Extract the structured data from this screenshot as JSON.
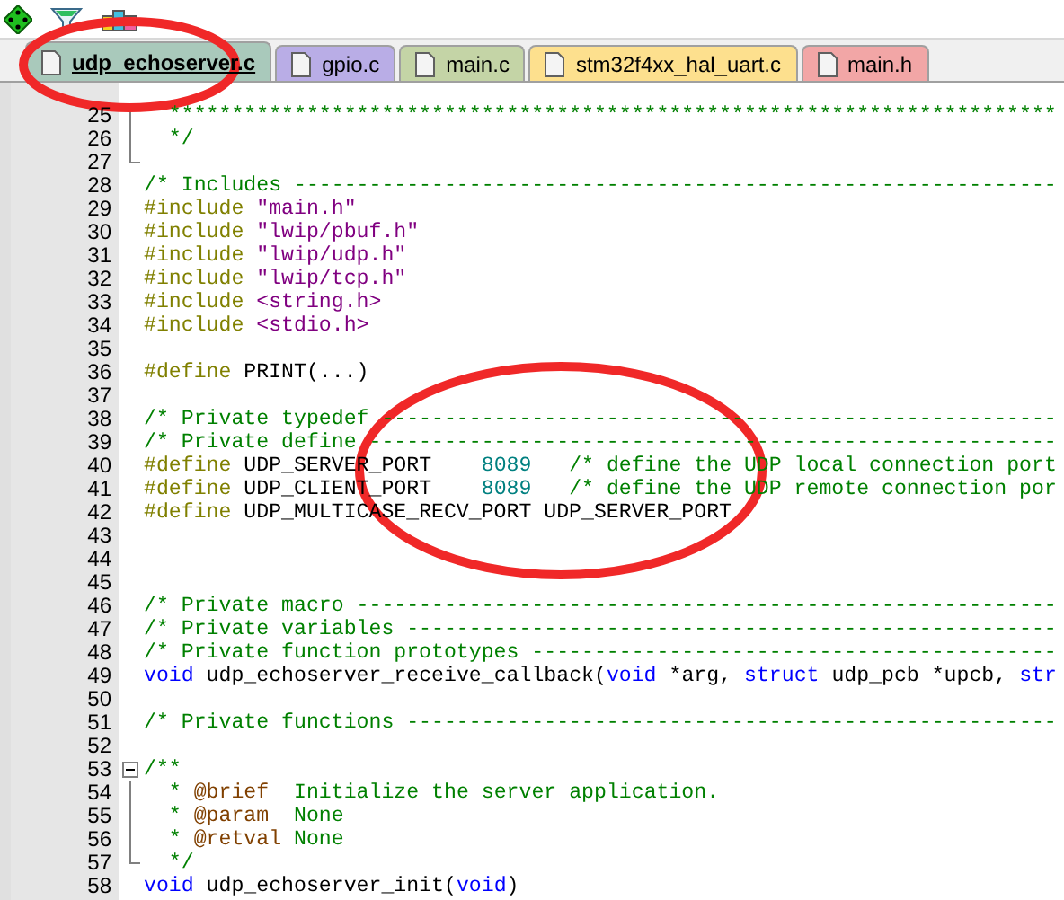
{
  "toolbar": {
    "buttons": [
      {
        "kind": "diamond"
      },
      {
        "kind": "funnel"
      },
      {
        "kind": "blocks"
      }
    ]
  },
  "tabs": [
    {
      "label": "udp_echoserver.c",
      "selected": true,
      "color": "#a9c9bb"
    },
    {
      "label": "gpio.c",
      "selected": false,
      "color": "#b9ade6"
    },
    {
      "label": "main.c",
      "selected": false,
      "color": "#c4d4a6"
    },
    {
      "label": "stm32f4xx_hal_uart.c",
      "selected": false,
      "color": "#fde08e"
    },
    {
      "label": "main.h",
      "selected": false,
      "color": "#f2a6a6"
    }
  ],
  "editor": {
    "lines": [
      {
        "number": "25",
        "kind": "foldline",
        "tokens": [
          {
            "text": "  ***********************************************************************",
            "kind": "comment"
          }
        ]
      },
      {
        "number": "26",
        "kind": "foldline",
        "tokens": [
          {
            "text": "  */",
            "kind": "comment"
          }
        ]
      },
      {
        "number": "27",
        "kind": "foldend"
      },
      {
        "number": "28",
        "tokens": [
          {
            "text": "/* Includes -------------------------------------------------------------",
            "kind": "comment"
          }
        ]
      },
      {
        "number": "29",
        "tokens": [
          {
            "text": "#include",
            "kind": "preproc"
          },
          {
            "text": " \"main.h\"",
            "kind": "string"
          }
        ]
      },
      {
        "number": "30",
        "tokens": [
          {
            "text": "#include",
            "kind": "preproc"
          },
          {
            "text": " \"lwip/pbuf.h\"",
            "kind": "string"
          }
        ]
      },
      {
        "number": "31",
        "tokens": [
          {
            "text": "#include",
            "kind": "preproc"
          },
          {
            "text": " \"lwip/udp.h\"",
            "kind": "string"
          }
        ]
      },
      {
        "number": "32",
        "tokens": [
          {
            "text": "#include",
            "kind": "preproc"
          },
          {
            "text": " \"lwip/tcp.h\"",
            "kind": "string"
          }
        ]
      },
      {
        "number": "33",
        "tokens": [
          {
            "text": "#include",
            "kind": "preproc"
          },
          {
            "text": " <string.h>",
            "kind": "string"
          }
        ]
      },
      {
        "number": "34",
        "tokens": [
          {
            "text": "#include",
            "kind": "preproc"
          },
          {
            "text": " <stdio.h>",
            "kind": "string"
          }
        ]
      },
      {
        "number": "35"
      },
      {
        "number": "36",
        "tokens": [
          {
            "text": "#define",
            "kind": "preproc"
          },
          {
            "text": " PRINT(...)",
            "kind": "plain"
          }
        ]
      },
      {
        "number": "37"
      },
      {
        "number": "38",
        "tokens": [
          {
            "text": "/* Private typedef ------------------------------------------------------",
            "kind": "comment"
          }
        ]
      },
      {
        "number": "39",
        "tokens": [
          {
            "text": "/* Private define -------------------------------------------------------",
            "kind": "comment"
          }
        ]
      },
      {
        "number": "40",
        "tokens": [
          {
            "text": "#define",
            "kind": "preproc"
          },
          {
            "text": " UDP_SERVER_PORT    ",
            "kind": "plain"
          },
          {
            "text": "8089",
            "kind": "number"
          },
          {
            "text": "   /* define the UDP local connection port",
            "kind": "comment"
          }
        ]
      },
      {
        "number": "41",
        "tokens": [
          {
            "text": "#define",
            "kind": "preproc"
          },
          {
            "text": " UDP_CLIENT_PORT    ",
            "kind": "plain"
          },
          {
            "text": "8089",
            "kind": "number"
          },
          {
            "text": "   /* define the UDP remote connection por",
            "kind": "comment"
          }
        ]
      },
      {
        "number": "42",
        "tokens": [
          {
            "text": "#define",
            "kind": "preproc"
          },
          {
            "text": " UDP_MULTICASE_RECV_PORT UDP_SERVER_PORT",
            "kind": "plain"
          }
        ]
      },
      {
        "number": "43"
      },
      {
        "number": "44"
      },
      {
        "number": "45"
      },
      {
        "number": "46",
        "tokens": [
          {
            "text": "/* Private macro --------------------------------------------------------",
            "kind": "comment"
          }
        ]
      },
      {
        "number": "47",
        "tokens": [
          {
            "text": "/* Private variables ----------------------------------------------------",
            "kind": "comment"
          }
        ]
      },
      {
        "number": "48",
        "tokens": [
          {
            "text": "/* Private function prototypes ------------------------------------------",
            "kind": "comment"
          }
        ]
      },
      {
        "number": "49",
        "tokens": [
          {
            "text": "void",
            "kind": "keyword"
          },
          {
            "text": " udp_echoserver_receive_callback(",
            "kind": "plain"
          },
          {
            "text": "void",
            "kind": "keyword"
          },
          {
            "text": " *arg, ",
            "kind": "plain"
          },
          {
            "text": "struct",
            "kind": "keyword"
          },
          {
            "text": " udp_pcb *upcb, ",
            "kind": "plain"
          },
          {
            "text": "str",
            "kind": "keyword"
          }
        ]
      },
      {
        "number": "50"
      },
      {
        "number": "51",
        "tokens": [
          {
            "text": "/* Private functions ----------------------------------------------------",
            "kind": "comment"
          }
        ]
      },
      {
        "number": "52"
      },
      {
        "number": "53",
        "kind": "foldstart",
        "tokens": [
          {
            "text": "/**",
            "kind": "comment"
          }
        ]
      },
      {
        "number": "54",
        "kind": "foldline",
        "tokens": [
          {
            "text": "  * ",
            "kind": "comment"
          },
          {
            "text": "@brief",
            "kind": "doctag"
          },
          {
            "text": "  Initialize the server application.",
            "kind": "comment"
          }
        ]
      },
      {
        "number": "55",
        "kind": "foldline",
        "tokens": [
          {
            "text": "  * ",
            "kind": "comment"
          },
          {
            "text": "@param",
            "kind": "doctag"
          },
          {
            "text": "  None",
            "kind": "comment"
          }
        ]
      },
      {
        "number": "56",
        "kind": "foldline",
        "tokens": [
          {
            "text": "  * ",
            "kind": "comment"
          },
          {
            "text": "@retval",
            "kind": "doctag"
          },
          {
            "text": " None",
            "kind": "comment"
          }
        ]
      },
      {
        "number": "57",
        "kind": "foldend",
        "tokens": [
          {
            "text": "  */",
            "kind": "comment"
          }
        ]
      },
      {
        "number": "58",
        "tokens": [
          {
            "text": "void",
            "kind": "keyword"
          },
          {
            "text": " udp_echoserver_init(",
            "kind": "plain"
          },
          {
            "text": "void",
            "kind": "keyword"
          },
          {
            "text": ")",
            "kind": "plain"
          }
        ]
      }
    ]
  },
  "annotations": [
    {
      "kind": "ellipse",
      "color": "#f02828"
    },
    {
      "kind": "ellipse",
      "color": "#f02828"
    }
  ]
}
